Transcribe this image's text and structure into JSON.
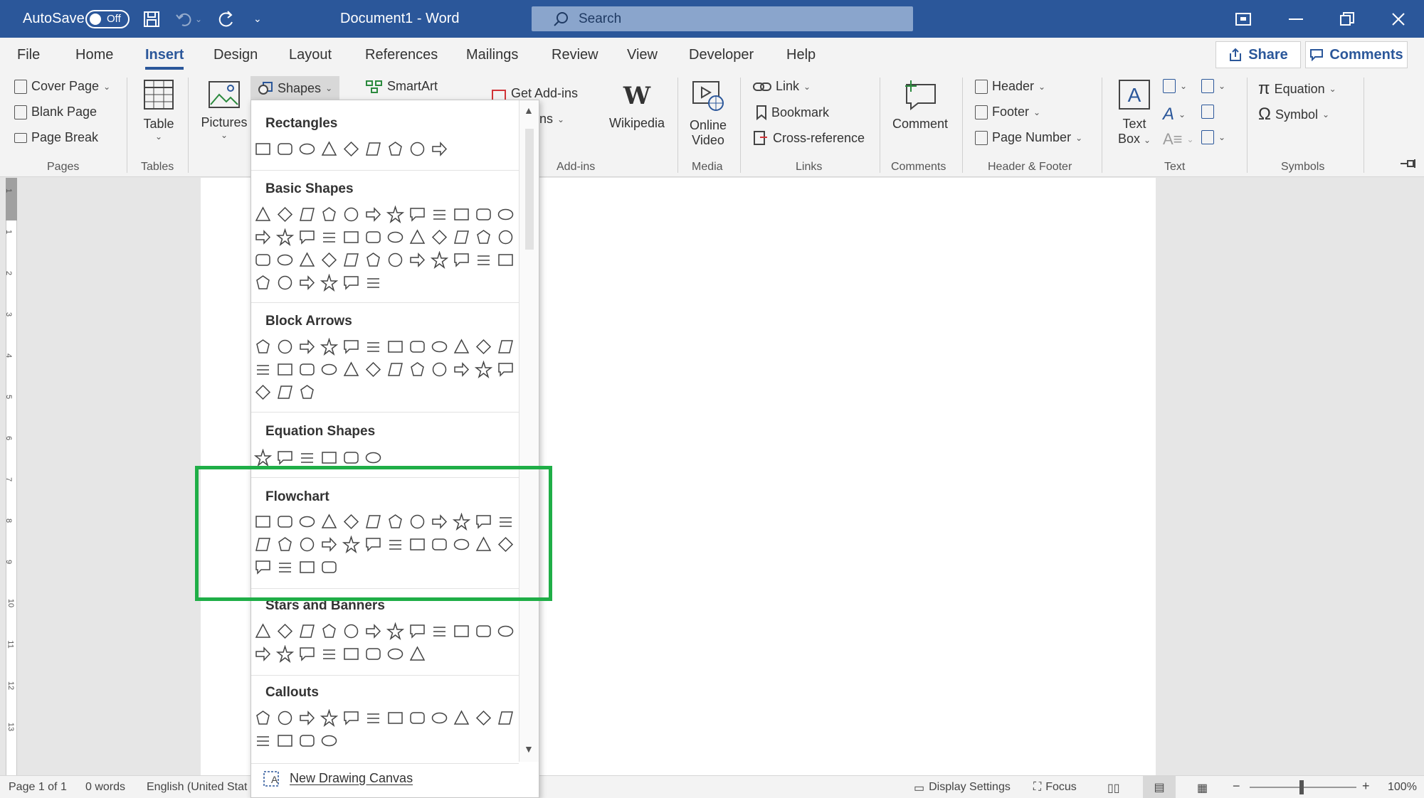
{
  "titlebar": {
    "autosave_label": "AutoSave",
    "autosave_state": "Off",
    "doc_title": "Document1  -  Word",
    "search_placeholder": "Search"
  },
  "tabs": [
    "File",
    "Home",
    "Insert",
    "Design",
    "Layout",
    "References",
    "Mailings",
    "Review",
    "View",
    "Developer",
    "Help"
  ],
  "active_tab": "Insert",
  "share_label": "Share",
  "comments_label": "Comments",
  "ribbon": {
    "pages": {
      "cover_page": "Cover Page",
      "blank_page": "Blank Page",
      "page_break": "Page Break",
      "group": "Pages"
    },
    "tables": {
      "table": "Table",
      "group": "Tables"
    },
    "illustrations": {
      "pictures": "Pictures",
      "shapes": "Shapes",
      "smartart": "SmartArt"
    },
    "addins": {
      "get_addins": "Get Add-ins",
      "my_addins": "Add-ins",
      "wikipedia": "Wikipedia",
      "group": "Add-ins"
    },
    "media": {
      "online": "Online",
      "video": "Video",
      "group": "Media"
    },
    "links": {
      "link": "Link",
      "bookmark": "Bookmark",
      "cross_reference": "Cross-reference",
      "group": "Links"
    },
    "comments": {
      "comment": "Comment",
      "group": "Comments"
    },
    "header_footer": {
      "header": "Header",
      "footer": "Footer",
      "page_number": "Page Number",
      "group": "Header & Footer"
    },
    "text": {
      "text": "Text",
      "box": "Box",
      "group": "Text"
    },
    "symbols": {
      "equation": "Equation",
      "symbol": "Symbol",
      "group": "Symbols"
    }
  },
  "shapes_menu": {
    "sections": [
      {
        "title": "Rectangles",
        "rows": [
          9
        ]
      },
      {
        "title": "Basic Shapes",
        "rows": [
          12,
          12,
          12,
          6
        ]
      },
      {
        "title": "Block Arrows",
        "rows": [
          12,
          12,
          3
        ]
      },
      {
        "title": "Equation Shapes",
        "rows": [
          6
        ]
      },
      {
        "title": "Flowchart",
        "rows": [
          12,
          12,
          4
        ]
      },
      {
        "title": "Stars and Banners",
        "rows": [
          12,
          8
        ]
      },
      {
        "title": "Callouts",
        "rows": [
          12,
          4
        ]
      }
    ],
    "new_canvas": "New Drawing Canvas",
    "highlight_color": "#1fae47"
  },
  "status": {
    "page": "Page 1 of 1",
    "words": "0 words",
    "language": "English (United Stat",
    "display_settings": "Display Settings",
    "focus": "Focus",
    "zoom": "100%"
  },
  "ruler_numbers": [
    "1",
    "1",
    "2",
    "3",
    "4",
    "5",
    "6",
    "7",
    "8",
    "9",
    "10",
    "11",
    "12",
    "13"
  ],
  "colors": {
    "title_bar": "#2b579a",
    "ribbon_bg": "#f3f3f3",
    "accent": "#2b579a"
  }
}
